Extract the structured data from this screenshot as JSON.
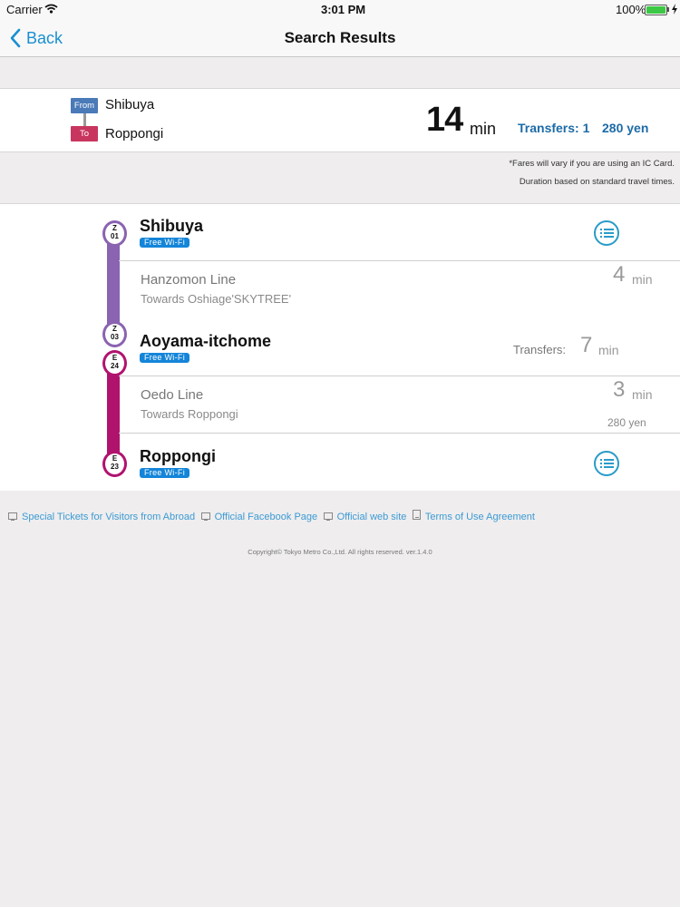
{
  "status_bar": {
    "carrier": "Carrier",
    "time": "3:01 PM",
    "battery": "100%"
  },
  "nav": {
    "back_label": "Back",
    "title": "Search Results"
  },
  "summary": {
    "from_tag": "From",
    "from_station": "Shibuya",
    "to_tag": "To",
    "to_station": "Roppongi",
    "duration": "14",
    "duration_unit": "min",
    "transfers": "Transfers: 1",
    "fare": "280 yen",
    "note1": "*Fares will vary if you are using an IC Card.",
    "note2": "Duration based on standard travel times."
  },
  "route": {
    "stops": [
      {
        "name": "Shibuya",
        "code_letter": "Z",
        "code_num": "01",
        "wifi": "Free Wi-Fi",
        "color": "#8a63b1"
      },
      {
        "name": "Aoyama-itchome",
        "code_letter": "Z",
        "code_num": "03",
        "code2_letter": "E",
        "code2_num": "24",
        "wifi": "Free Wi-Fi",
        "transfer_label": "Transfers:",
        "transfer_value": "7",
        "transfer_unit": "min",
        "color": "#8a63b1",
        "color2": "#b0136e"
      },
      {
        "name": "Roppongi",
        "code_letter": "E",
        "code_num": "23",
        "wifi": "Free Wi-Fi",
        "color": "#b0136e"
      }
    ],
    "segments": [
      {
        "line": "Hanzomon Line",
        "towards": "Towards Oshiage'SKYTREE'",
        "time": "4",
        "unit": "min",
        "color": "#8a63b1"
      },
      {
        "line": "Oedo Line",
        "towards": "Towards Roppongi",
        "time": "3",
        "unit": "min",
        "fare": "280 yen",
        "color": "#b0136e"
      }
    ]
  },
  "footer": {
    "links": [
      "Special Tickets for Visitors from Abroad",
      "Official Facebook Page",
      "Official web site",
      "Terms of Use Agreement"
    ],
    "copyright": "Copyright© Tokyo Metro Co.,Ltd. All rights reserved. ver.1.4.0"
  },
  "colors": {
    "accent": "#1a8fd1",
    "hanzomon": "#8a63b1",
    "oedo": "#b0136e",
    "from_tag": "#4a7ab8",
    "to_tag": "#c8365f"
  }
}
